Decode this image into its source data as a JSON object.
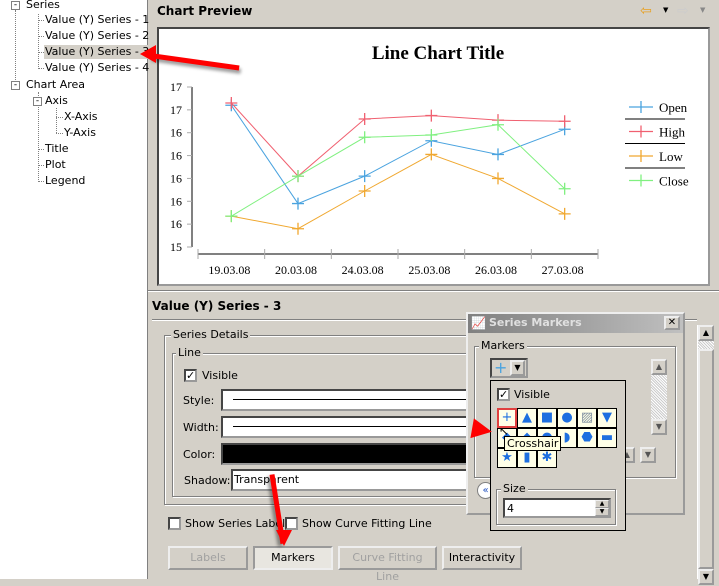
{
  "tree": {
    "series": "Series",
    "series_items": [
      "Value (Y) Series - 1",
      "Value (Y) Series - 2",
      "Value (Y) Series - 3",
      "Value (Y) Series - 4"
    ],
    "chart_area": "Chart Area",
    "axis": "Axis",
    "x_axis": "X-Axis",
    "y_axis": "Y-Axis",
    "title": "Title",
    "plot": "Plot",
    "legend": "Legend"
  },
  "preview": {
    "title": "Chart Preview",
    "back_icon": "back-arrow-icon",
    "forward_icon": "forward-arrow-icon"
  },
  "chart_data": {
    "type": "line",
    "title": "Line Chart Title",
    "categories": [
      "19.03.08",
      "20.03.08",
      "24.03.08",
      "25.03.08",
      "26.03.08",
      "27.03.08"
    ],
    "ylim": [
      15.4,
      16.8
    ],
    "yticks": [
      15.4,
      15.6,
      15.8,
      16.0,
      16.2,
      16.4,
      16.6,
      16.8
    ],
    "ytick_labels": [
      "15",
      "16",
      "16",
      "16",
      "16",
      "16",
      "17",
      "17"
    ],
    "legend_placement": "right",
    "marker": "crosshair",
    "series": [
      {
        "name": "Open",
        "color": "#4aa3df",
        "values": [
          16.64,
          15.78,
          16.02,
          16.33,
          16.21,
          16.43
        ]
      },
      {
        "name": "High",
        "color": "#f06070",
        "values": [
          16.66,
          16.02,
          16.52,
          16.55,
          16.51,
          16.5
        ]
      },
      {
        "name": "Low",
        "color": "#f0a830",
        "values": [
          15.67,
          15.56,
          15.89,
          16.21,
          16.0,
          15.69
        ]
      },
      {
        "name": "Close",
        "color": "#80f080",
        "values": [
          15.67,
          16.02,
          16.36,
          16.38,
          16.47,
          15.91
        ]
      }
    ]
  },
  "editor": {
    "heading": "Value (Y) Series - 3",
    "series_details": "Series Details",
    "line": "Line",
    "visible": "Visible",
    "style": "Style:",
    "width": "Width:",
    "color": "Color:",
    "shadow": "Shadow:",
    "shadow_value": "Transparent",
    "color_value": "#000000",
    "show_series_labels": "Show Series Labels",
    "show_curve_fitting": "Show Curve Fitting Line",
    "buttons": [
      "Labels",
      "Markers",
      "Curve Fitting Line",
      "Interactivity"
    ]
  },
  "dialog": {
    "title": "Series Markers",
    "markers": "Markers",
    "visible": "Visible",
    "tooltip": "Crosshair",
    "size": "Size",
    "size_value": "4"
  }
}
